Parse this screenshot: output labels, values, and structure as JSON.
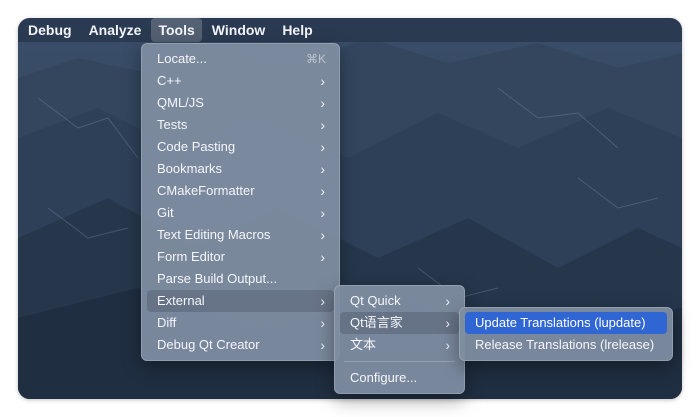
{
  "menubar": [
    "Debug",
    "Analyze",
    "Tools",
    "Window",
    "Help"
  ],
  "tools_menu": {
    "locate": {
      "label": "Locate...",
      "shortcut": "⌘K"
    },
    "items": [
      "C++",
      "QML/JS",
      "Tests",
      "Code Pasting",
      "Bookmarks",
      "CMakeFormatter",
      "Git",
      "Text Editing Macros",
      "Form Editor"
    ],
    "parse_build_output": "Parse Build Output...",
    "external": "External",
    "diff": "Diff",
    "debug_qt_creator": "Debug Qt Creator"
  },
  "external_menu": {
    "qt_quick": "Qt Quick",
    "qt_linguist": "Qt语言家",
    "text": "文本",
    "configure": "Configure..."
  },
  "linguist_menu": {
    "update": "Update Translations (lupdate)",
    "release": "Release Translations (lrelease)"
  },
  "icons": {
    "submenu": "chevron-right-icon"
  },
  "colors": {
    "selection": "#2f66d3",
    "menu_bg": "#808da2"
  }
}
